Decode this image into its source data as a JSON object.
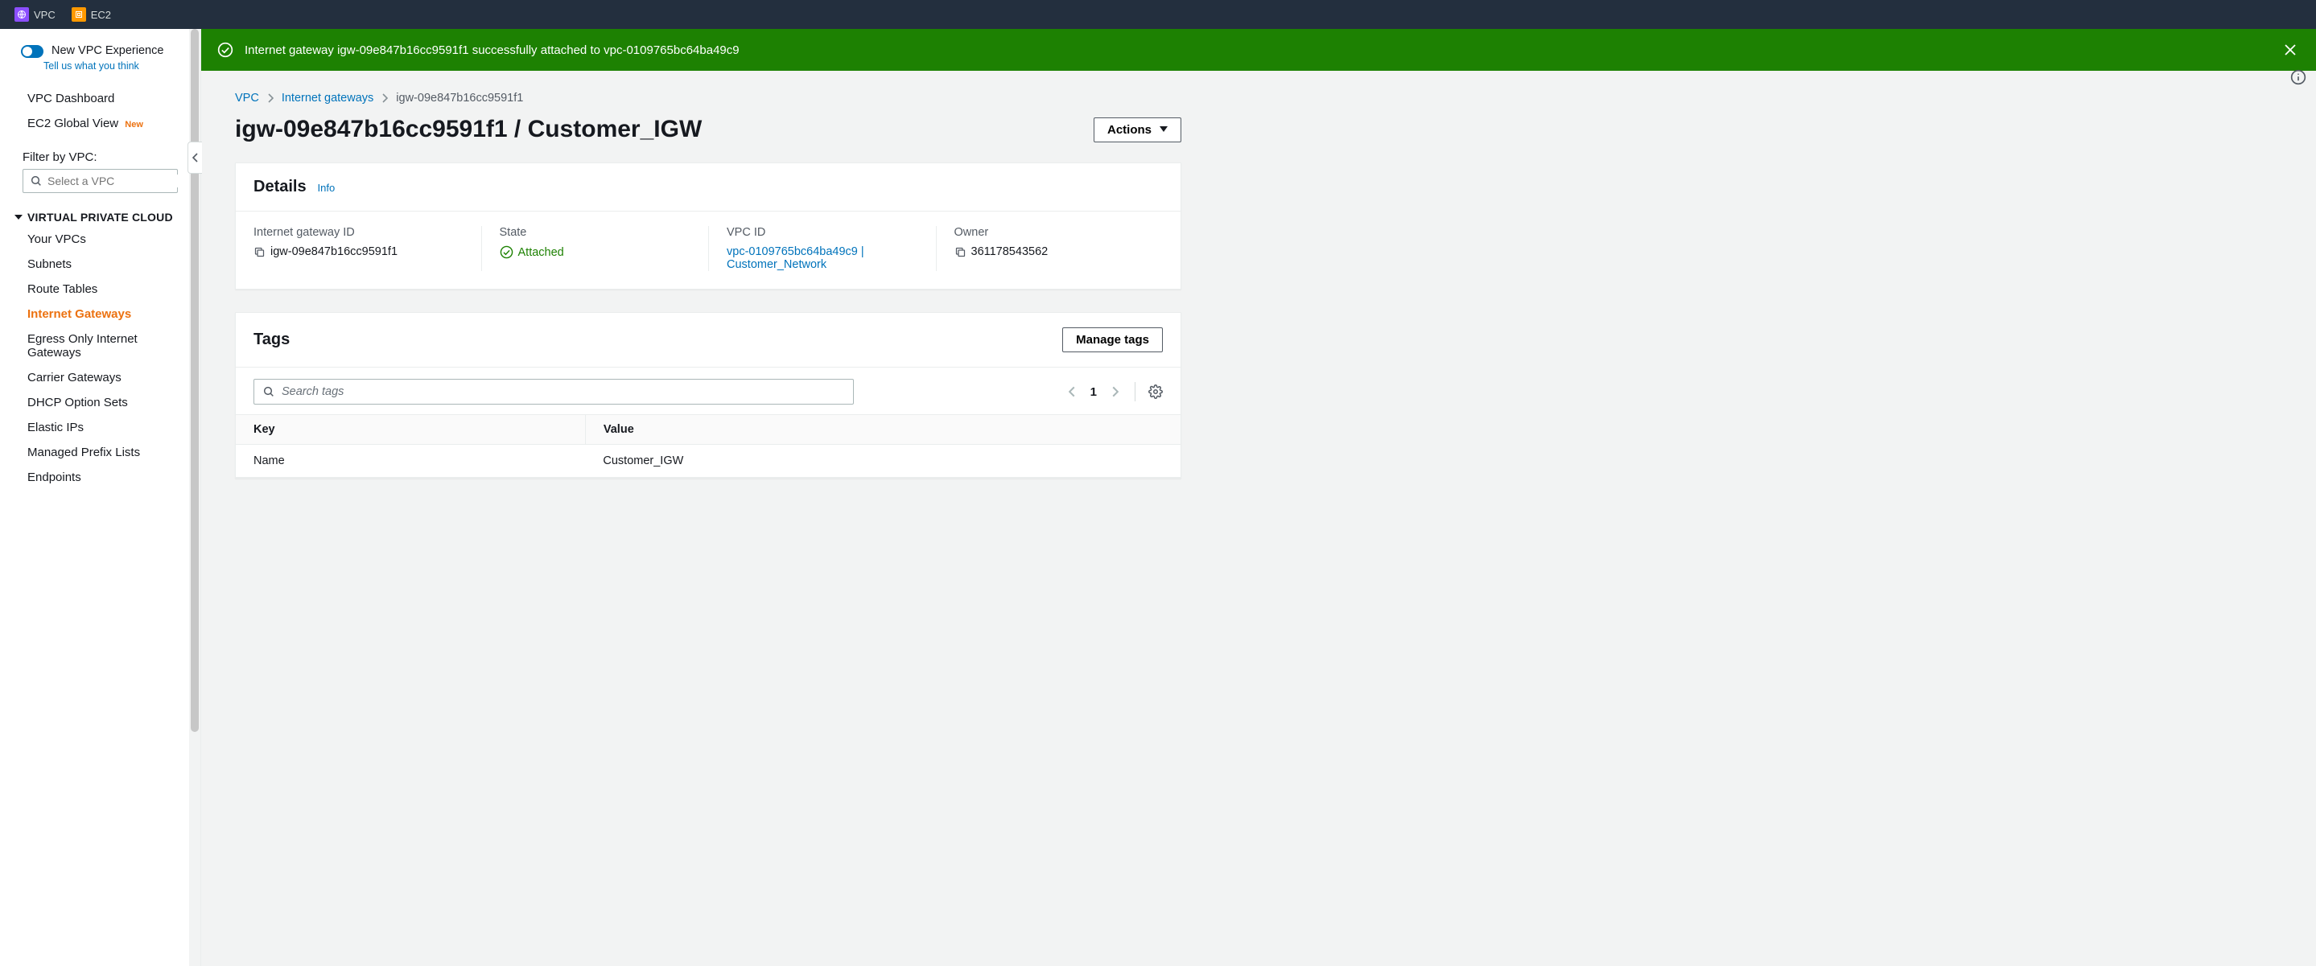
{
  "service_bar": {
    "items": [
      {
        "label": "VPC",
        "icon": "vpc"
      },
      {
        "label": "EC2",
        "icon": "ec2"
      }
    ]
  },
  "sidebar": {
    "experience": {
      "title": "New VPC Experience",
      "feedback_link": "Tell us what you think"
    },
    "top_links": [
      {
        "label": "VPC Dashboard"
      },
      {
        "label": "EC2 Global View",
        "badge": "New"
      }
    ],
    "filter": {
      "label": "Filter by VPC:",
      "placeholder": "Select a VPC"
    },
    "group": {
      "title": "VIRTUAL PRIVATE CLOUD",
      "items": [
        {
          "label": "Your VPCs"
        },
        {
          "label": "Subnets"
        },
        {
          "label": "Route Tables"
        },
        {
          "label": "Internet Gateways",
          "active": true
        },
        {
          "label": "Egress Only Internet Gateways"
        },
        {
          "label": "Carrier Gateways"
        },
        {
          "label": "DHCP Option Sets"
        },
        {
          "label": "Elastic IPs"
        },
        {
          "label": "Managed Prefix Lists"
        },
        {
          "label": "Endpoints"
        }
      ]
    }
  },
  "flash": {
    "message": "Internet gateway igw-09e847b16cc9591f1 successfully attached to vpc-0109765bc64ba49c9"
  },
  "breadcrumbs": {
    "root": "VPC",
    "mid": "Internet gateways",
    "current": "igw-09e847b16cc9591f1"
  },
  "page": {
    "title": "igw-09e847b16cc9591f1 / Customer_IGW",
    "actions_label": "Actions"
  },
  "details": {
    "title": "Details",
    "info_label": "Info",
    "igw_id": {
      "label": "Internet gateway ID",
      "value": "igw-09e847b16cc9591f1"
    },
    "state": {
      "label": "State",
      "value": "Attached"
    },
    "vpc_id": {
      "label": "VPC ID",
      "value": "vpc-0109765bc64ba49c9 | Customer_Network"
    },
    "owner": {
      "label": "Owner",
      "value": "361178543562"
    }
  },
  "tags": {
    "title": "Tags",
    "manage_label": "Manage tags",
    "search_placeholder": "Search tags",
    "page_number": "1",
    "columns": {
      "key": "Key",
      "value": "Value"
    },
    "rows": [
      {
        "key": "Name",
        "value": "Customer_IGW"
      }
    ]
  }
}
